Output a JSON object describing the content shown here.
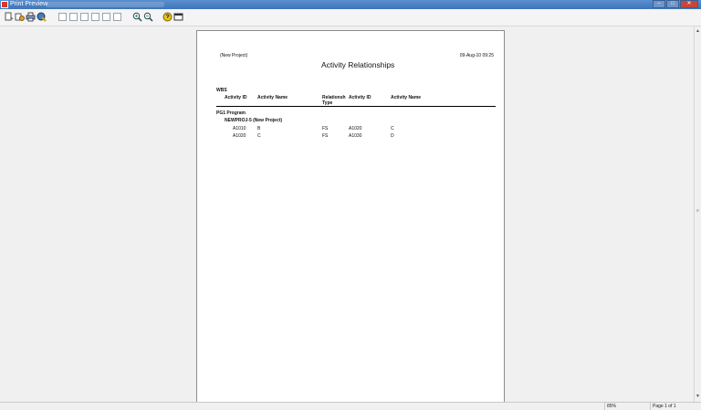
{
  "window": {
    "title": "Print Preview",
    "minimize": "–",
    "maximize": "□",
    "close": "✕"
  },
  "toolbar": {
    "icons": [
      "page-setup-icon",
      "print-options-icon",
      "print-icon",
      "publish-icon",
      "first-page-icon",
      "previous-page-icon",
      "page-icon",
      "next-page-icon",
      "last-page-icon",
      "page-view-icon",
      "zoom-in-icon",
      "zoom-out-icon",
      "help-icon",
      "close-preview-icon"
    ]
  },
  "report": {
    "header_left": "(New Project)",
    "header_right": "09-Aug-10 09:25",
    "title": "Activity Relationships",
    "group_label": "WBS",
    "columns": {
      "activity_id": "Activity ID",
      "activity_name": "Activity Name",
      "relationship_type_1": "Relationsh",
      "relationship_type_2": "Type",
      "succ_activity_id": "Activity ID",
      "succ_activity_name": "Activity Name"
    },
    "program": "PG1  Program",
    "project": "NEWPROJ-5  (New Project)",
    "rows": [
      {
        "id": "A1010",
        "name": "B",
        "type": "FS",
        "succ_id": "A1020",
        "succ_name": "C"
      },
      {
        "id": "A1020",
        "name": "C",
        "type": "FS",
        "succ_id": "A1030",
        "succ_name": "D"
      }
    ]
  },
  "status": {
    "zoom": "85%",
    "page": "Page 1 of 1"
  }
}
